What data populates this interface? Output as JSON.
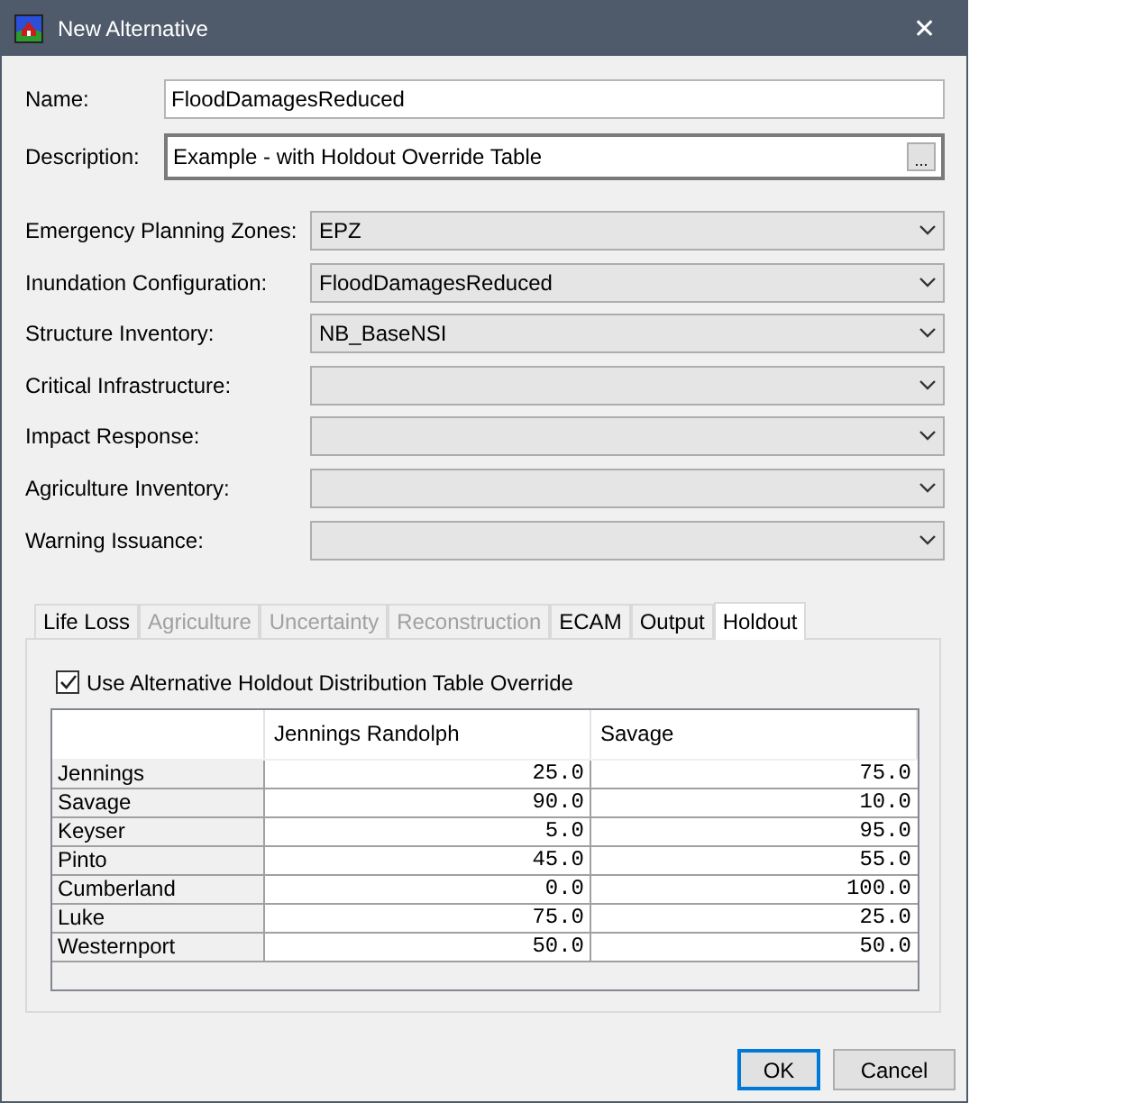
{
  "window": {
    "title": "New Alternative",
    "close": "✕"
  },
  "name": {
    "label": "Name:",
    "value": "FloodDamagesReduced"
  },
  "description": {
    "label": "Description:",
    "value": "Example - with Holdout Override Table",
    "button": "..."
  },
  "selectors": [
    {
      "label": "Emergency Planning Zones:",
      "value": "EPZ"
    },
    {
      "label": "Inundation Configuration:",
      "value": "FloodDamagesReduced"
    },
    {
      "label": "Structure Inventory:",
      "value": "NB_BaseNSI"
    },
    {
      "label": "Critical Infrastructure:"
    },
    {
      "label": "Impact Response:"
    },
    {
      "label": "Agriculture Inventory:"
    },
    {
      "label": "Warning Issuance:"
    }
  ],
  "tabs": [
    {
      "label": "Life Loss",
      "selected": false,
      "disabled": false
    },
    {
      "label": "Agriculture",
      "selected": false,
      "disabled": true
    },
    {
      "label": "Uncertainty",
      "selected": false,
      "disabled": true
    },
    {
      "label": "Reconstruction",
      "selected": false,
      "disabled": true
    },
    {
      "label": "ECAM",
      "selected": false,
      "disabled": false
    },
    {
      "label": "Output",
      "selected": false,
      "disabled": false
    },
    {
      "label": "Holdout",
      "selected": true,
      "disabled": false
    }
  ],
  "override": {
    "label": "Use Alternative Holdout Distribution Table Override",
    "checked": true
  },
  "table": {
    "columns": [
      "Jennings Randolph",
      "Savage"
    ],
    "rows": [
      {
        "name": "Jennings",
        "values": [
          "25.0",
          "75.0"
        ]
      },
      {
        "name": "Savage",
        "values": [
          "90.0",
          "10.0"
        ]
      },
      {
        "name": "Keyser",
        "values": [
          "5.0",
          "95.0"
        ]
      },
      {
        "name": "Pinto",
        "values": [
          "45.0",
          "55.0"
        ]
      },
      {
        "name": "Cumberland",
        "values": [
          "0.0",
          "100.0"
        ]
      },
      {
        "name": "Luke",
        "values": [
          "75.0",
          "25.0"
        ]
      },
      {
        "name": "Westernport",
        "values": [
          "50.0",
          "50.0"
        ]
      }
    ]
  },
  "buttons": [
    {
      "label": "OK",
      "default": true
    },
    {
      "label": "Cancel",
      "default": false
    }
  ]
}
